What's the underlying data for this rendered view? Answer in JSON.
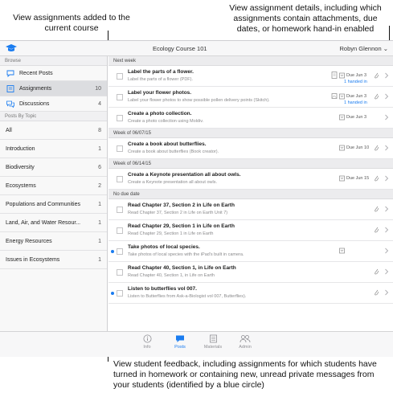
{
  "callouts": {
    "top_left": "View assignments added to the current course",
    "top_right": "View assignment details, including which assignments contain attachments, due dates, or homework hand-in enabled",
    "bottom": "View student feedback, including assignments for which students have turned in homework or containing new, unread private messages from your students (identified by a blue circle)"
  },
  "navbar": {
    "title": "Ecology Course 101",
    "user": "Robyn Glennon ⌄"
  },
  "sidebar": {
    "browse_label": "Browse",
    "browse_items": [
      {
        "label": "Recent Posts",
        "count": "",
        "icon": "chat-bubble-icon"
      },
      {
        "label": "Assignments",
        "count": "10",
        "icon": "assignment-list-icon"
      },
      {
        "label": "Discussions",
        "count": "4",
        "icon": "discussion-bubbles-icon"
      }
    ],
    "topics_label": "Posts By Topic",
    "topics": [
      {
        "label": "All",
        "count": "8"
      },
      {
        "label": "Introduction",
        "count": "1"
      },
      {
        "label": "Biodiversity",
        "count": "6"
      },
      {
        "label": "Ecosystems",
        "count": "2"
      },
      {
        "label": "Populations and Communities",
        "count": "1"
      },
      {
        "label": "Land, Air, and Water Resour...",
        "count": "1"
      },
      {
        "label": "Energy Resources",
        "count": "1"
      },
      {
        "label": "Issues in Ecosystems",
        "count": "1"
      }
    ]
  },
  "sections": {
    "next_week": "Next week",
    "week_0707": "Week of 06/07/15",
    "week_0614": "Week of 06/14/15",
    "no_due": "No due date"
  },
  "assignments": {
    "a1": {
      "title": "Label the parts of a flower.",
      "sub": "Label the parts of a flower (PDF).",
      "due": "Due Jun 3",
      "handed": "1 handed in"
    },
    "a2": {
      "title": "Label your flower photos.",
      "sub": "Label your flower photos to show possible pollen delivery points (Skitch).",
      "due": "Due Jun 3",
      "handed": "1 handed in"
    },
    "a3": {
      "title": "Create a photo collection.",
      "sub": "Create a photo collection using Moldiv.",
      "due": "Due Jun 3"
    },
    "a4": {
      "title": "Create a book about butterflies.",
      "sub": "Create a book about butterflies (Book creator).",
      "due": "Due Jun 10"
    },
    "a5": {
      "title": "Create a Keynote presentation all about owls.",
      "sub": "Create a Keynote presentation all about owls.",
      "due": "Due Jun 15"
    },
    "a6": {
      "title": "Read Chapter 37, Section 2 in Life on Earth",
      "sub": "Read Chapter 37, Section 2 in Life on Earth Unit 7)"
    },
    "a7": {
      "title": "Read Chapter 29, Section 1 in Life on Earth",
      "sub": "Read Chapter 29, Section 1 in Life on Earth"
    },
    "a8": {
      "title": "Take photos of local species.",
      "sub": "Take photos of local species with the iPad's built in camera."
    },
    "a9": {
      "title": "Read Chapter 40, Section 1, in Life on Earth",
      "sub": "Read Chapter 40, Section 1, in Life on Earth"
    },
    "a10": {
      "title": "Listen to butterflies vol 007.",
      "sub": "Listen to Butterflies from Ask-a-Biologist vol 007, Butterflies)."
    }
  },
  "tabbar": {
    "info": "Info",
    "posts": "Posts",
    "materials": "Materials",
    "admin": "Admin"
  },
  "colors": {
    "accent": "#1a7cf0",
    "unread_dot": "#1a7cf0",
    "selected_row": "#dcdde0"
  }
}
